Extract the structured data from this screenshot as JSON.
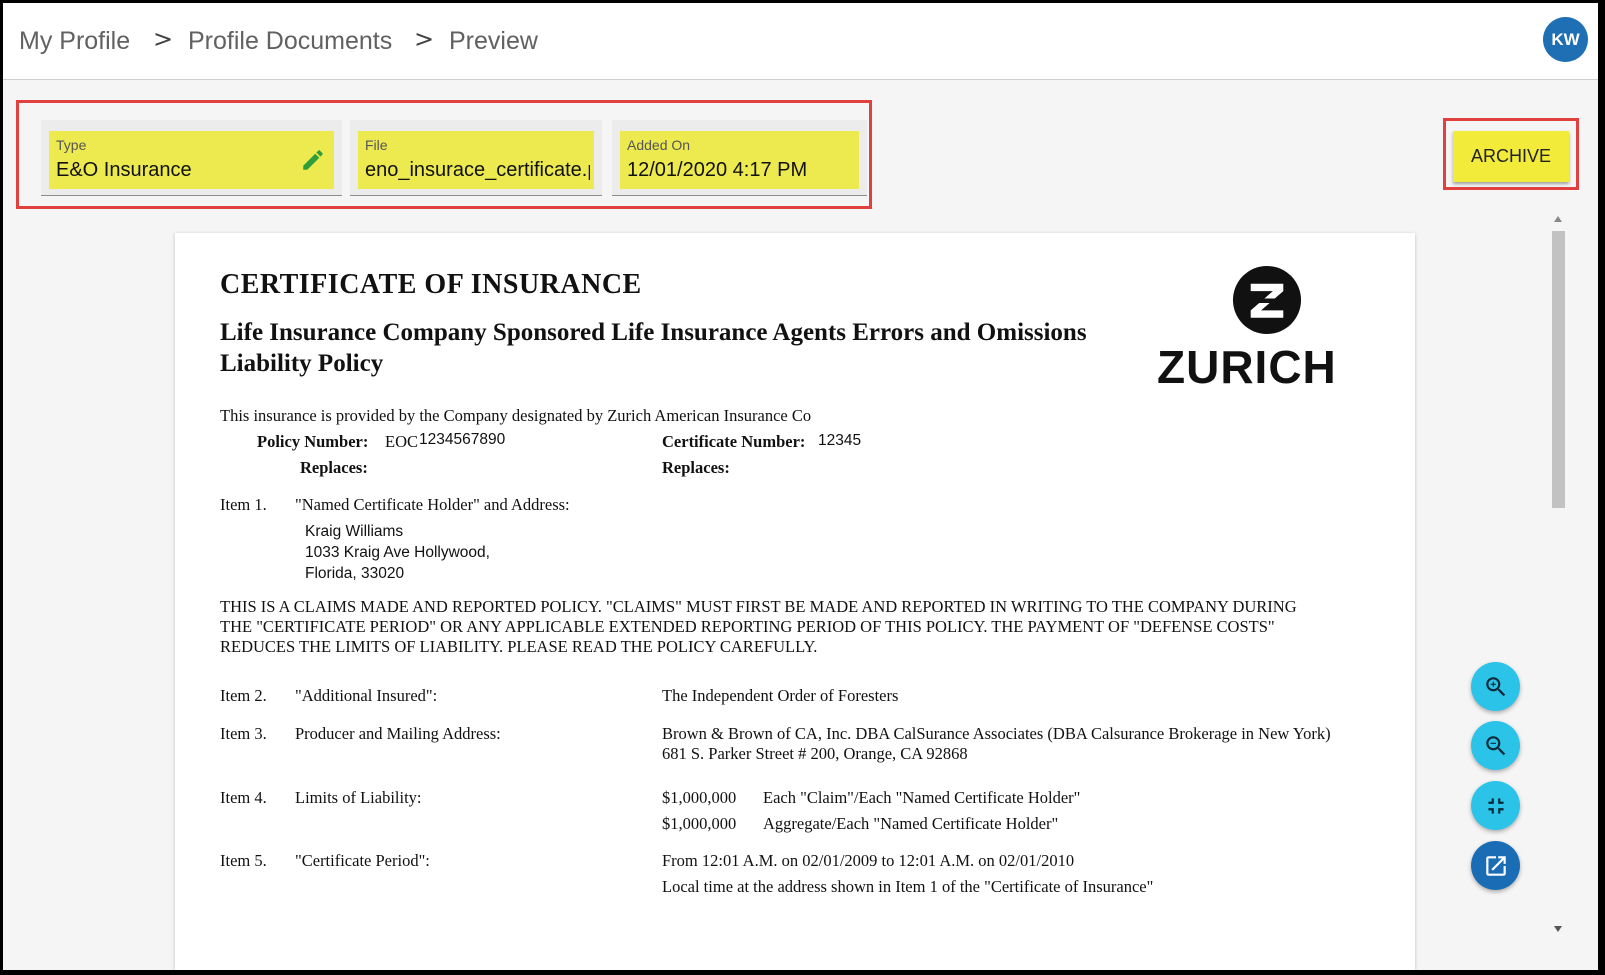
{
  "breadcrumb": {
    "items": [
      "My Profile",
      "Profile Documents",
      "Preview"
    ],
    "separator": ">"
  },
  "user": {
    "initials": "KW"
  },
  "fields": {
    "type": {
      "label": "Type",
      "value": "E&O Insurance"
    },
    "file": {
      "label": "File",
      "value": "eno_insurace_certificate.pdf"
    },
    "added_on": {
      "label": "Added On",
      "value": "12/01/2020 4:17 PM"
    }
  },
  "actions": {
    "archive_label": "ARCHIVE"
  },
  "document": {
    "title": "CERTIFICATE OF INSURANCE",
    "subtitle_line1": "Life Insurance Company Sponsored Life Insurance Agents Errors and Omissions",
    "subtitle_line2": "Liability Policy",
    "brand": "ZURICH",
    "provided_by": "This insurance is provided by the Company designated by Zurich American Insurance Co",
    "policy_number_label": "Policy Number:",
    "policy_number_prefix": "EOC",
    "policy_number_value": "1234567890",
    "certificate_number_label": "Certificate Number:",
    "certificate_number_value": "12345",
    "replaces_label": "Replaces:",
    "item1_label": "Item 1.",
    "item1_text": "\"Named Certificate Holder\" and Address:",
    "holder_name": "Kraig Williams",
    "holder_address1": "1033 Kraig Ave Hollywood,",
    "holder_address2": "Florida, 33020",
    "notice_line1": "THIS IS A CLAIMS MADE AND REPORTED POLICY.  \"CLAIMS\" MUST FIRST BE MADE AND REPORTED IN WRITING TO THE COMPANY DURING",
    "notice_line2": "THE \"CERTIFICATE PERIOD\" OR ANY APPLICABLE EXTENDED REPORTING PERIOD OF THIS POLICY.  THE PAYMENT OF \"DEFENSE COSTS\"",
    "notice_line3": "REDUCES THE LIMITS OF LIABILITY.  PLEASE READ THE POLICY CAREFULLY.",
    "item2_label": "Item 2.",
    "item2_text": "\"Additional Insured\":",
    "item2_value": "The Independent Order of Foresters",
    "item3_label": "Item 3.",
    "item3_text": "Producer and Mailing Address:",
    "item3_value1": "Brown & Brown of CA, Inc. DBA CalSurance Associates (DBA Calsurance Brokerage in New York)",
    "item3_value2": "681 S. Parker Street # 200, Orange, CA 92868",
    "item4_label": "Item 4.",
    "item4_text": "Limits of Liability:",
    "limit1_amount": "$1,000,000",
    "limit1_desc": "Each \"Claim\"/Each \"Named Certificate Holder\"",
    "limit2_amount": "$1,000,000",
    "limit2_desc": "Aggregate/Each \"Named Certificate Holder\"",
    "item5_label": "Item 5.",
    "item5_text": "\"Certificate Period\":",
    "item5_value1": "From 12:01 A.M. on 02/01/2009 to 12:01 A.M. on 02/01/2010",
    "item5_value2": "Local time at the address shown in Item 1 of the \"Certificate of Insurance\""
  },
  "colors": {
    "highlight": "#ecea4e",
    "annotation_box": "#e0413f",
    "fab": "#2bc3e8",
    "fab_dark": "#1a6db5",
    "avatar": "#1f6fb5"
  },
  "icons": {
    "edit": "pencil-icon",
    "zoom_in": "zoom-in-icon",
    "zoom_out": "zoom-out-icon",
    "fit": "collapse-icon",
    "open_external": "open-in-new-icon"
  }
}
